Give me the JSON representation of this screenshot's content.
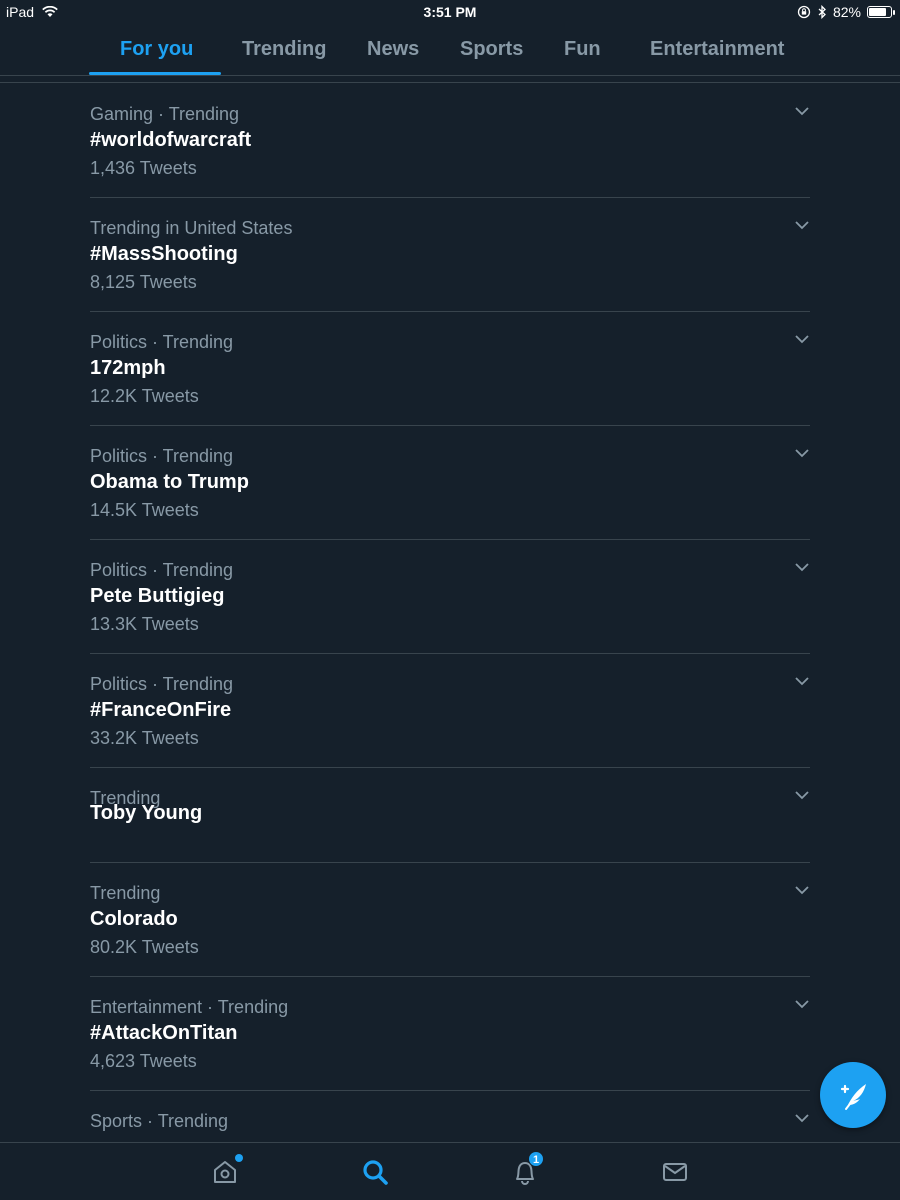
{
  "status_bar": {
    "device": "iPad",
    "time": "3:51 PM",
    "battery_percent": "82%",
    "battery_level": 0.82,
    "icons": [
      "wifi-icon",
      "orientation-lock-icon",
      "bluetooth-icon",
      "battery-icon"
    ]
  },
  "tabs": [
    {
      "label": "For you",
      "active": true
    },
    {
      "label": "Trending",
      "active": false
    },
    {
      "label": "News",
      "active": false
    },
    {
      "label": "Sports",
      "active": false
    },
    {
      "label": "Fun",
      "active": false
    },
    {
      "label": "Entertainment",
      "active": false
    }
  ],
  "trends": [
    {
      "context": "Gaming · Trending",
      "name": "#worldofwarcraft",
      "count": "1,436 Tweets"
    },
    {
      "context": "Trending in United States",
      "name": "#MassShooting",
      "count": "8,125 Tweets"
    },
    {
      "context": "Politics · Trending",
      "name": "172mph",
      "count": "12.2K Tweets"
    },
    {
      "context": "Politics · Trending",
      "name": "Obama to Trump",
      "count": "14.5K Tweets"
    },
    {
      "context": "Politics · Trending",
      "name": "Pete Buttigieg",
      "count": "13.3K Tweets"
    },
    {
      "context": "Politics · Trending",
      "name": "#FranceOnFire",
      "count": "33.2K Tweets"
    },
    {
      "context": "Trending",
      "name": "Toby Young",
      "count": ""
    },
    {
      "context": "Trending",
      "name": "Colorado",
      "count": "80.2K Tweets"
    },
    {
      "context": "Entertainment · Trending",
      "name": "#AttackOnTitan",
      "count": "4,623 Tweets"
    },
    {
      "context": "Sports · Trending",
      "name": "",
      "count": ""
    }
  ],
  "bottom_nav": {
    "items": [
      {
        "icon": "home-icon",
        "active": false,
        "has_dot": true
      },
      {
        "icon": "search-icon",
        "active": true
      },
      {
        "icon": "notifications-icon",
        "active": false,
        "badge": "1"
      },
      {
        "icon": "messages-icon",
        "active": false
      }
    ]
  },
  "compose": {
    "icon": "compose-tweet-icon"
  },
  "colors": {
    "background": "#15202b",
    "accent": "#1da1f2",
    "secondary_text": "#8899a6",
    "divider": "#38444d"
  }
}
